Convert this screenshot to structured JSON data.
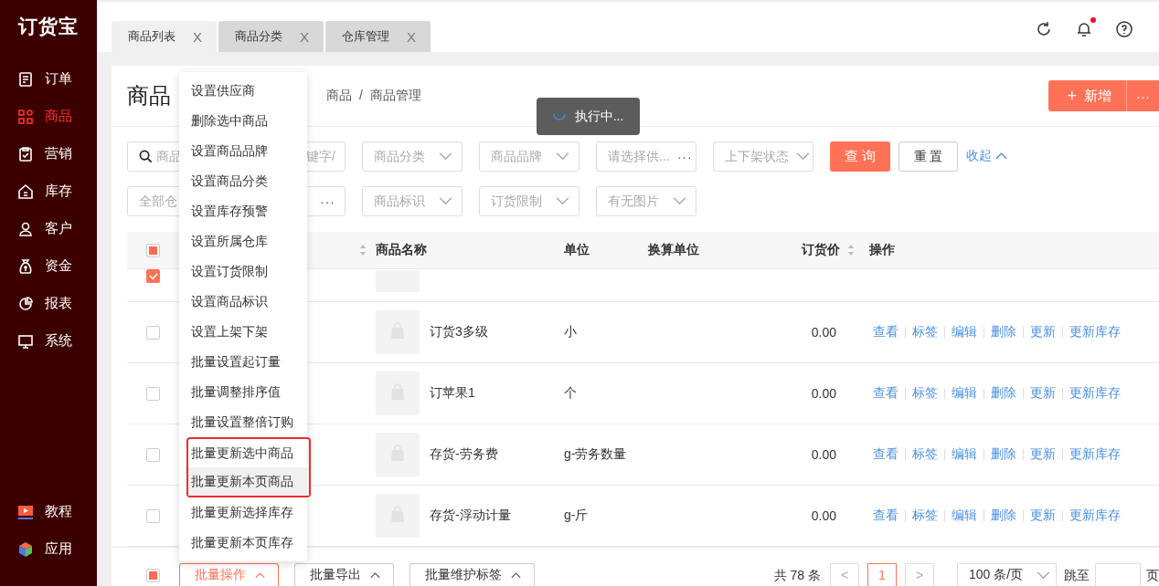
{
  "logo": "订货宝",
  "sidebar": {
    "items": [
      {
        "label": "订单",
        "selected": false
      },
      {
        "label": "商品",
        "selected": true
      },
      {
        "label": "营销",
        "selected": false
      },
      {
        "label": "库存",
        "selected": false
      },
      {
        "label": "客户",
        "selected": false
      },
      {
        "label": "资金",
        "selected": false
      },
      {
        "label": "报表",
        "selected": false
      },
      {
        "label": "系统",
        "selected": false
      }
    ],
    "bottom_items": [
      {
        "label": "教程"
      },
      {
        "label": "应用"
      }
    ]
  },
  "tabs": [
    {
      "label": "商品列表",
      "close": "X",
      "selected": true
    },
    {
      "label": "商品分类",
      "close": "X",
      "selected": false
    },
    {
      "label": "仓库管理",
      "close": "X",
      "selected": false
    }
  ],
  "bell_badge": true,
  "page": {
    "title": "商品",
    "breadcrumb": [
      "商品",
      "商品管理"
    ],
    "breadcrumb_separator": "/",
    "add_button": "新增",
    "add_icon": "+",
    "more_button": "···"
  },
  "loading_toast": "执行中...",
  "filters": {
    "rows": [
      [
        {
          "kind": "search",
          "placeholder": "商品",
          "tail": "键字/"
        },
        {
          "kind": "select",
          "placeholder": "商品分类"
        },
        {
          "kind": "select",
          "placeholder": "商品品牌"
        },
        {
          "kind": "picker",
          "placeholder": "请选择供...",
          "suffix": "···"
        },
        {
          "kind": "select",
          "placeholder": "上下架状态"
        }
      ],
      [
        {
          "kind": "picker",
          "placeholder": "全部仓",
          "suffix": "···"
        },
        {
          "kind": "select",
          "placeholder": "商品标识"
        },
        {
          "kind": "select",
          "placeholder": "订货限制"
        },
        {
          "kind": "select",
          "placeholder": "有无图片"
        }
      ]
    ],
    "query": "查 询",
    "reset": "重 置",
    "collapse": "收起"
  },
  "table": {
    "header_checkbox_indeterminate": true,
    "columns": [
      {
        "kind": "hidden",
        "sortable": true
      },
      {
        "kind": "name",
        "label": "商品名称",
        "sortable": false
      },
      {
        "kind": "unit",
        "label": "单位",
        "sortable": false
      },
      {
        "kind": "conv",
        "label": "换算单位",
        "sortable": false
      },
      {
        "kind": "price",
        "label": "订货价",
        "sortable": true
      },
      {
        "kind": "actions",
        "label": "操作",
        "sortable": false
      }
    ],
    "rows": [
      {
        "kind": "partial",
        "checked": true
      },
      {
        "kind": "full",
        "checked": false,
        "name": "订货3多级",
        "unit": "小",
        "price": "0.00",
        "actions": [
          "查看",
          "标签",
          "编辑",
          "删除",
          "更新",
          "更新库存"
        ]
      },
      {
        "kind": "full",
        "checked": false,
        "name": "订苹果1",
        "unit": "个",
        "price": "0.00",
        "actions": [
          "查看",
          "标签",
          "编辑",
          "删除",
          "更新",
          "更新库存"
        ]
      },
      {
        "kind": "full",
        "checked": false,
        "name": "存货-劳务费",
        "unit": "g-劳务数量",
        "price": "0.00",
        "actions": [
          "查看",
          "标签",
          "编辑",
          "删除",
          "更新",
          "更新库存"
        ]
      },
      {
        "kind": "full",
        "checked": false,
        "name": "存货-浮动计量",
        "unit": "g-斤",
        "price": "0.00",
        "actions": [
          "查看",
          "标签",
          "编辑",
          "删除",
          "更新",
          "更新库存"
        ]
      }
    ]
  },
  "footer": {
    "checkbox_indeterminate": true,
    "batch_buttons": [
      {
        "label": "批量操作",
        "active": true
      },
      {
        "label": "批量导出",
        "active": false
      },
      {
        "label": "批量维护标签",
        "active": false
      }
    ],
    "total": "共 78 条",
    "prev": "<",
    "next": ">",
    "pages": [
      {
        "label": "1",
        "selected": true
      }
    ],
    "page_size": "100 条/页",
    "jump_label": "跳至",
    "page_suffix": "页"
  },
  "menu": {
    "items": [
      {
        "label": "设置供应商",
        "hovered": false,
        "marked": false
      },
      {
        "label": "删除选中商品",
        "hovered": false,
        "marked": false
      },
      {
        "label": "设置商品品牌",
        "hovered": false,
        "marked": false
      },
      {
        "label": "设置商品分类",
        "hovered": false,
        "marked": false
      },
      {
        "label": "设置库存预警",
        "hovered": false,
        "marked": false
      },
      {
        "label": "设置所属仓库",
        "hovered": false,
        "marked": false
      },
      {
        "label": "设置订货限制",
        "hovered": false,
        "marked": false
      },
      {
        "label": "设置商品标识",
        "hovered": false,
        "marked": false
      },
      {
        "label": "设置上架下架",
        "hovered": false,
        "marked": false
      },
      {
        "label": "批量设置起订量",
        "hovered": false,
        "marked": false
      },
      {
        "label": "批量调整排序值",
        "hovered": false,
        "marked": false
      },
      {
        "label": "批量设置整倍订购",
        "hovered": false,
        "marked": false
      },
      {
        "label": "批量更新选中商品",
        "hovered": false,
        "marked": true
      },
      {
        "label": "批量更新本页商品",
        "hovered": true,
        "marked": true
      },
      {
        "label": "批量更新选择库存",
        "hovered": false,
        "marked": false
      },
      {
        "label": "批量更新本页库存",
        "hovered": false,
        "marked": false
      }
    ]
  }
}
